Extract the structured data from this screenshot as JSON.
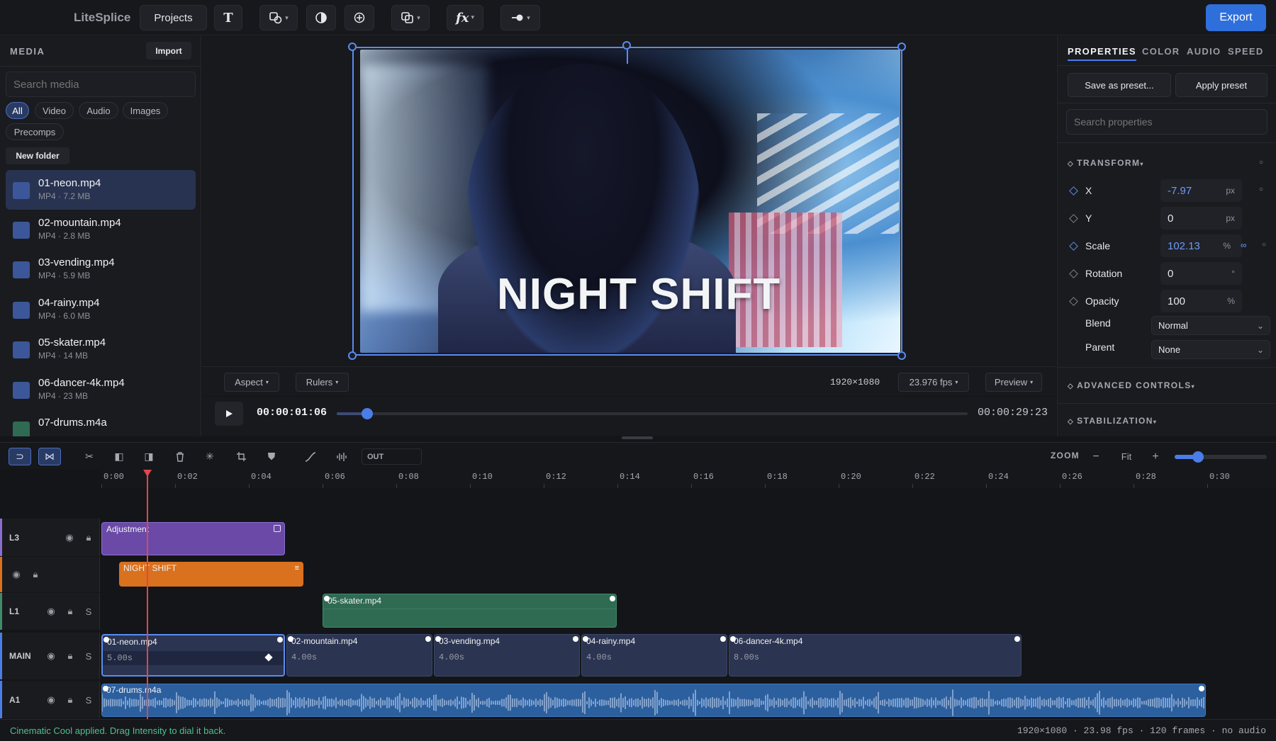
{
  "app": {
    "name": "LiteSplice"
  },
  "toolbar": {
    "projects_label": "Projects",
    "text_icon": "T",
    "fx_icon": "fx",
    "export_label": "Export"
  },
  "media": {
    "title": "MEDIA",
    "import_label": "Import",
    "search_placeholder": "Search media",
    "filters": [
      "All",
      "Video",
      "Audio",
      "Images",
      "Precomps"
    ],
    "active_filter": "All",
    "new_folder_label": "New folder",
    "items": [
      {
        "name": "01-neon.mp4",
        "meta": "MP4 · 7.2 MB",
        "selected": true
      },
      {
        "name": "02-mountain.mp4",
        "meta": "MP4 · 2.8 MB"
      },
      {
        "name": "03-vending.mp4",
        "meta": "MP4 · 5.9 MB"
      },
      {
        "name": "04-rainy.mp4",
        "meta": "MP4 · 6.0 MB"
      },
      {
        "name": "05-skater.mp4",
        "meta": "MP4 · 14 MB"
      },
      {
        "name": "06-dancer-4k.mp4",
        "meta": "MP4 · 23 MB"
      },
      {
        "name": "07-drums.m4a",
        "meta": ""
      }
    ]
  },
  "viewer": {
    "overlay_title": "NIGHT SHIFT",
    "aspect_label": "Aspect",
    "rulers_label": "Rulers",
    "resolution": "1920×1080",
    "fps_label": "23.976 fps",
    "preview_label": "Preview",
    "current_time": "00:00:01:06",
    "duration": "00:00:29:23",
    "playhead_fraction": 0.048
  },
  "properties": {
    "tabs": [
      "PROPERTIES",
      "COLOR",
      "AUDIO",
      "SPEED"
    ],
    "active_tab": "PROPERTIES",
    "save_preset_label": "Save as preset...",
    "apply_preset_label": "Apply preset",
    "search_placeholder": "Search properties",
    "transform_title": "TRANSFORM",
    "rows": [
      {
        "label": "X",
        "value": "-7.97",
        "unit": "px",
        "keyframed": true
      },
      {
        "label": "Y",
        "value": "0",
        "unit": "px",
        "keyframed": false
      },
      {
        "label": "Scale",
        "value": "102.13",
        "unit": "%",
        "keyframed": true
      },
      {
        "label": "Rotation",
        "value": "0",
        "unit": "°",
        "keyframed": false
      },
      {
        "label": "Opacity",
        "value": "100",
        "unit": "%",
        "keyframed": false
      }
    ],
    "blend_label": "Blend",
    "blend_value": "Normal",
    "parent_label": "Parent",
    "parent_value": "None",
    "advanced_title": "ADVANCED CONTROLS",
    "stabilization_title": "STABILIZATION"
  },
  "timeline": {
    "out_label": "OUT",
    "zoom_label": "ZOOM",
    "zoom_minus": "−",
    "fit_label": "Fit",
    "zoom_plus": "+",
    "zoom_fraction": 0.25,
    "ruler_ticks": [
      "0:00",
      "0:02",
      "0:04",
      "0:06",
      "0:08",
      "0:10",
      "0:12",
      "0:14",
      "0:16",
      "0:18",
      "0:20",
      "0:22",
      "0:24",
      "0:26",
      "0:28",
      "0:30"
    ],
    "playhead_seconds": 1.25,
    "tracks": {
      "l3": {
        "label": "L3"
      },
      "text": {
        "label": ""
      },
      "l1": {
        "label": "L1"
      },
      "main": {
        "label": "MAIN"
      },
      "a1": {
        "label": "A1"
      }
    },
    "solo_label": "S",
    "clips": {
      "adjustment": {
        "label": "Adjustment"
      },
      "night_shift": {
        "label": "NIGHT SHIFT"
      },
      "skater": {
        "label": "05-skater.mp4"
      },
      "main": [
        {
          "label": "01-neon.mp4",
          "duration": "5.00s"
        },
        {
          "label": "02-mountain.mp4",
          "duration": "4.00s"
        },
        {
          "label": "03-vending.mp4",
          "duration": "4.00s"
        },
        {
          "label": "04-rainy.mp4",
          "duration": "4.00s"
        },
        {
          "label": "06-dancer-4k.mp4",
          "duration": "8.00s"
        }
      ],
      "audio": {
        "label": "07-drums.m4a"
      }
    }
  },
  "status": {
    "message": "Cinematic Cool applied. Drag Intensity to dial it back.",
    "info": "1920×1080 · 23.98 fps · 120 frames · no audio"
  },
  "colors": {
    "accent": "#2f6fdc",
    "selection": "#5a8bf0",
    "adjustment": "#6a4aa6",
    "text_clip": "#d9711e",
    "video_clip": "#2f6b52",
    "main_clip": "#2b3552",
    "audio_clip": "#2c5f9e",
    "playhead": "#e0474c",
    "status_text": "#4fc08a"
  }
}
